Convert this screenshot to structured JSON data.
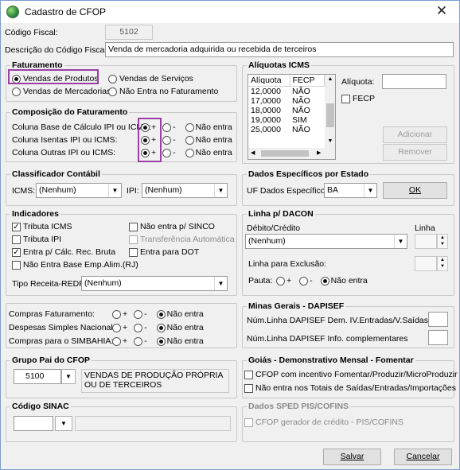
{
  "window": {
    "title": "Cadastro de CFOP",
    "close": "✕"
  },
  "codigo_fiscal": {
    "label": "Código Fiscal:",
    "value": "5102"
  },
  "descricao": {
    "label": "Descrição do Código Fiscal:",
    "value": "Venda de mercadoria adquirida ou recebida de terceiros"
  },
  "faturamento": {
    "title": "Faturamento",
    "options": [
      "Vendas de Produtos",
      "Vendas de Serviços",
      "Vendas de Mercadorias",
      "Não Entra no Faturamento"
    ],
    "selected": "Vendas de Produtos"
  },
  "composicao": {
    "title": "Composição do Faturamento",
    "rows": [
      {
        "label": "Coluna Base de Cálculo IPI ou ICMS:",
        "selected": "+"
      },
      {
        "label": "Coluna Isentas IPI ou ICMS:",
        "selected": "+"
      },
      {
        "label": "Coluna Outras IPI ou ICMS:",
        "selected": "+"
      }
    ],
    "opt_plus": "+",
    "opt_minus": "-",
    "opt_nao": "Não entra"
  },
  "classificador": {
    "title": "Classificador Contábil",
    "icms_label": "ICMS:",
    "icms_value": "(Nenhum)",
    "ipi_label": "IPI:",
    "ipi_value": "(Nenhum)"
  },
  "indicadores": {
    "title": "Indicadores",
    "left": [
      {
        "label": "Tributa ICMS",
        "checked": true
      },
      {
        "label": "Tributa IPI",
        "checked": false
      },
      {
        "label": "Entra p/ Cálc. Rec. Bruta",
        "checked": true
      },
      {
        "label": "Não Entra Base Emp.Alim.(RJ)",
        "checked": false
      }
    ],
    "right": [
      {
        "label": "Não entra p/ SINCO",
        "checked": false,
        "disabled": false
      },
      {
        "label": "Transferência Automática",
        "checked": false,
        "disabled": true
      },
      {
        "label": "Entra para DOT",
        "checked": false,
        "disabled": false
      }
    ],
    "tipo_label": "Tipo Receita-REDF:",
    "tipo_value": "(Nenhum)"
  },
  "compras": {
    "rows": [
      {
        "label": "Compras Faturamento:"
      },
      {
        "label": "Despesas Simples Nacional:"
      },
      {
        "label": "Compras para o SIMBAHIA:"
      }
    ],
    "opt_plus": "+",
    "opt_minus": "-",
    "opt_nao": "Não entra",
    "selected": "Não entra"
  },
  "grupo_pai": {
    "title": "Grupo Pai do CFOP",
    "code": "5100",
    "description": "VENDAS DE PRODUÇÃO PRÓPRIA OU DE TERCEIROS"
  },
  "sinac": {
    "title": "Código SINAC",
    "code": "",
    "description": ""
  },
  "aliquotas": {
    "title": "Alíquotas ICMS",
    "columns": [
      "Alíquota",
      "FECP"
    ],
    "rows": [
      [
        "12,0000",
        "NÃO"
      ],
      [
        "17,0000",
        "NÃO"
      ],
      [
        "18,0000",
        "NÃO"
      ],
      [
        "19,0000",
        "SIM"
      ],
      [
        "25,0000",
        "NÃO"
      ]
    ],
    "aliquota_label": "Alíquota:",
    "aliquota_value": "",
    "fecp_label": "FECP",
    "adicionar": "Adicionar",
    "remover": "Remover"
  },
  "dados_estado": {
    "title": "Dados Específicos por Estado",
    "uf_label": "UF Dados Específicos:",
    "uf_value": "BA",
    "ok": "OK"
  },
  "dacon": {
    "title": "Linha p/ DACON",
    "debito_label": "Débito/Crédito",
    "debito_value": "(Nenhum)",
    "linha_label": "Linha",
    "linha_value": "",
    "exclusao_label": "Linha para Exclusão:",
    "exclusao_value": "",
    "pauta_label": "Pauta:",
    "opt_plus": "+",
    "opt_minus": "-",
    "opt_nao": "Não entra",
    "selected": "Não entra"
  },
  "minas": {
    "title": "Minas Gerais - DAPISEF",
    "row1": "Núm.Linha DAPISEF Dem. IV.Entradas/V.Saídas",
    "row2": "Núm.Linha DAPISEF Info. complementares"
  },
  "goias": {
    "title": "Goiás - Demonstrativo Mensal - Fomentar",
    "opt1": "CFOP com incentivo  Fomentar/Produzir/MicroProduzir",
    "opt2": "Não entra nos Totais de  Saídas/Entradas/Importações"
  },
  "sped": {
    "title": "Dados SPED PIS/COFINS",
    "opt1": "CFOP gerador de crédito - PIS/COFINS"
  },
  "buttons": {
    "salvar": "Salvar",
    "cancelar": "Cancelar"
  }
}
